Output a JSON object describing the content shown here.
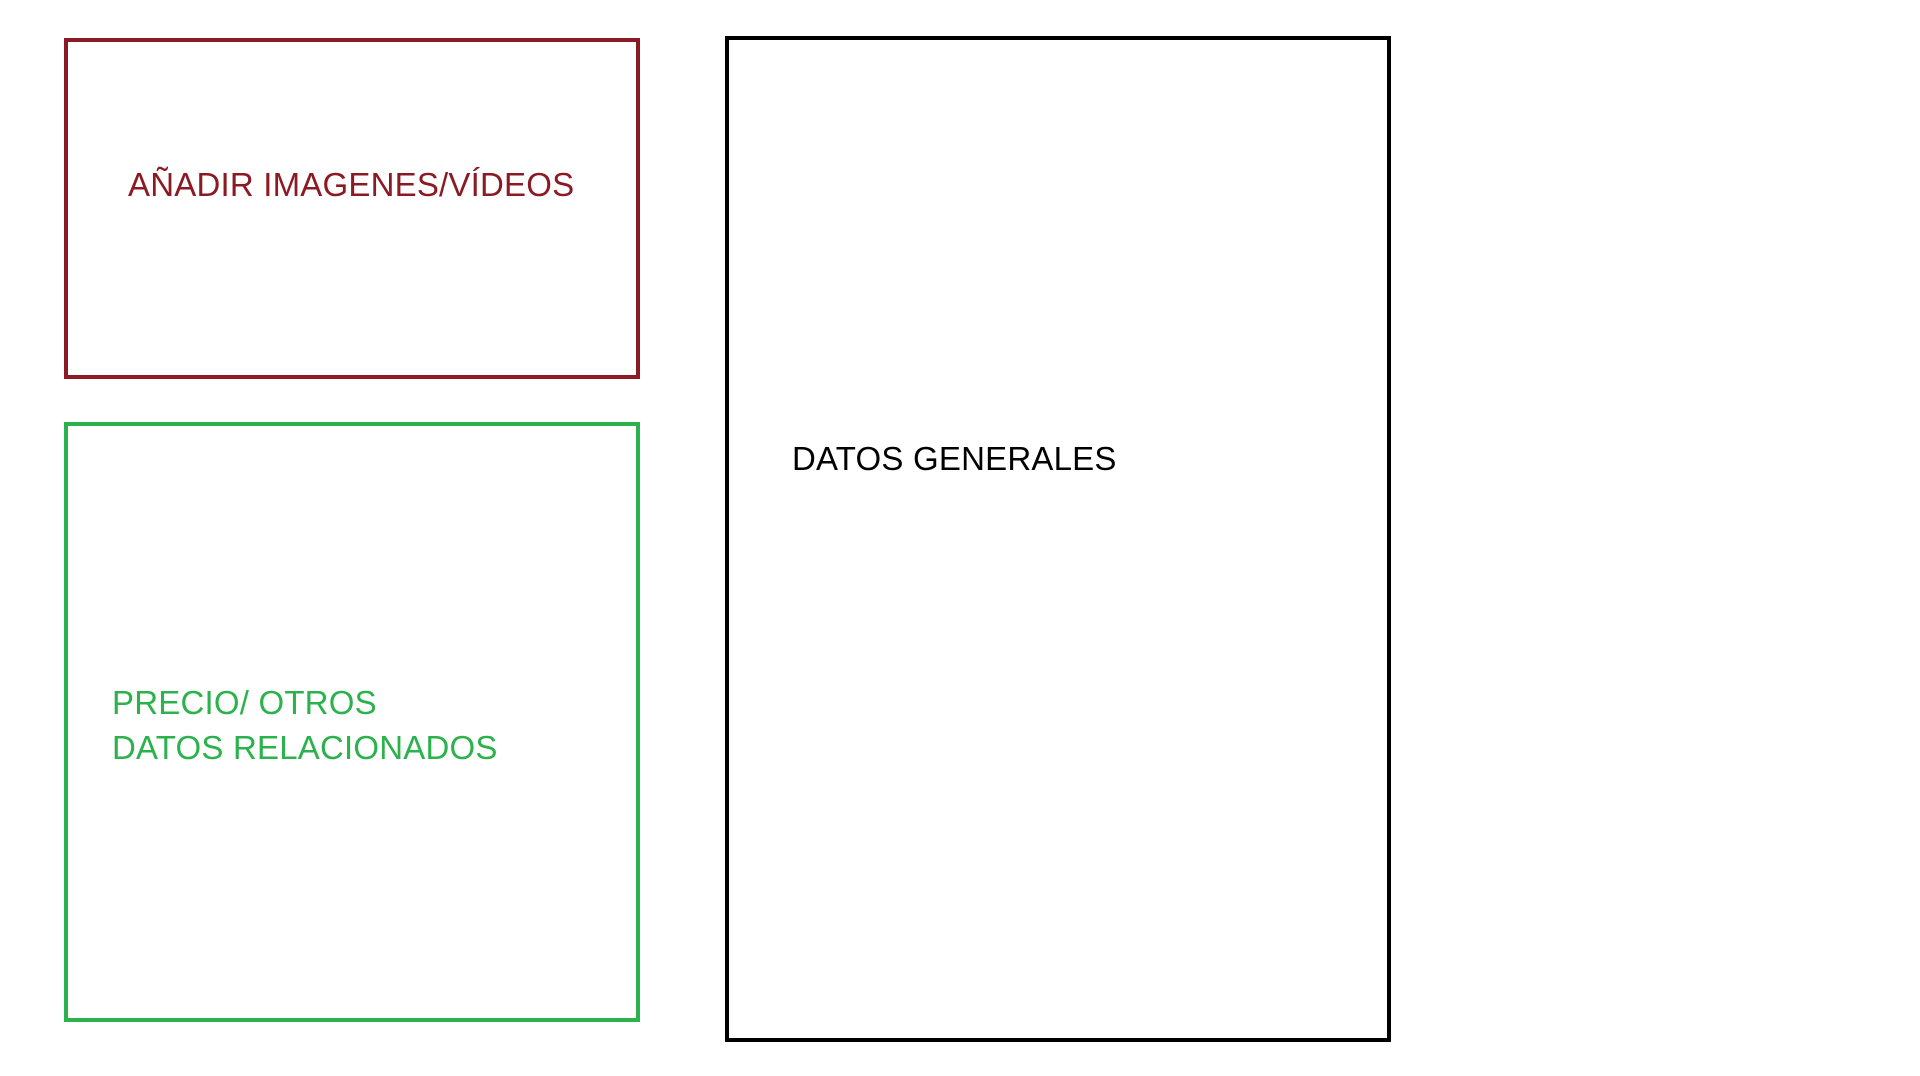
{
  "diagram": {
    "boxes": {
      "media": {
        "label": "AÑADIR IMAGENES/VÍDEOS",
        "color": "#8b1a24"
      },
      "price": {
        "label_lines": [
          "PRECIO/ OTROS",
          "DATOS RELACIONADOS"
        ],
        "color": "#2bb24c"
      },
      "general": {
        "label": "DATOS GENERALES",
        "color": "#000000"
      }
    }
  }
}
